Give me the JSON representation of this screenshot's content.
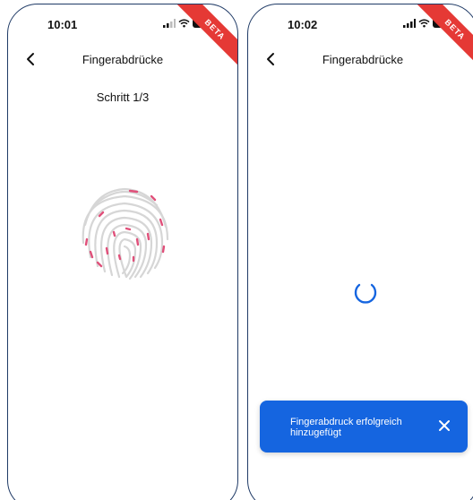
{
  "colors": {
    "frame_border": "#1f3a66",
    "beta_ribbon": "#e53935",
    "accent_blue": "#1565e0",
    "fingerprint_gray": "#d6d6d6",
    "fingerprint_pink": "#e0507a"
  },
  "screens": [
    {
      "status_bar": {
        "time": "10:01",
        "icons": [
          "signal-icon",
          "wifi-icon",
          "battery-icon"
        ]
      },
      "beta_label": "BETA",
      "nav": {
        "back_icon": "chevron-left-icon",
        "title": "Fingerabdrücke"
      },
      "step_label": "Schritt 1/3",
      "illustration": "fingerprint-icon"
    },
    {
      "status_bar": {
        "time": "10:02",
        "icons": [
          "signal-icon",
          "wifi-icon",
          "battery-icon"
        ]
      },
      "beta_label": "BETA",
      "nav": {
        "back_icon": "chevron-left-icon",
        "title": "Fingerabdrücke"
      },
      "loading_icon": "spinner-icon",
      "snackbar": {
        "line1": "Fingerabdruck erfolgreich",
        "line2": "hinzugefügt",
        "close_icon": "close-icon"
      }
    }
  ]
}
